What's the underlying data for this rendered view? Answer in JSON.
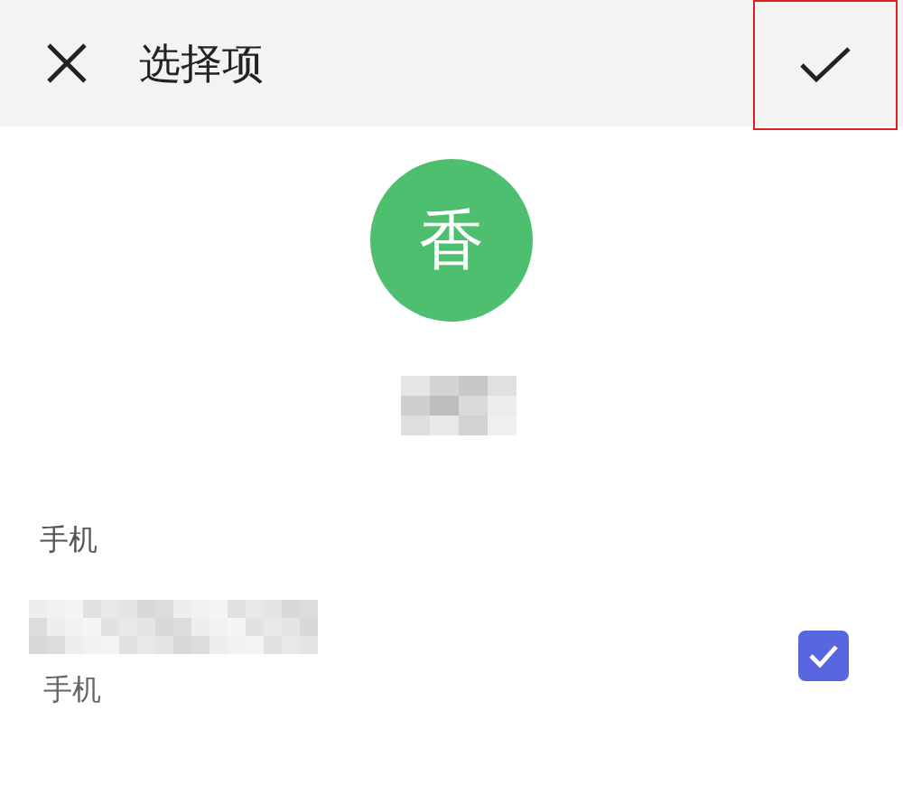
{
  "header": {
    "title": "选择项"
  },
  "avatar": {
    "text": "香"
  },
  "section": {
    "title": "手机"
  },
  "entries": [
    {
      "label": "手机",
      "checked": true
    }
  ]
}
